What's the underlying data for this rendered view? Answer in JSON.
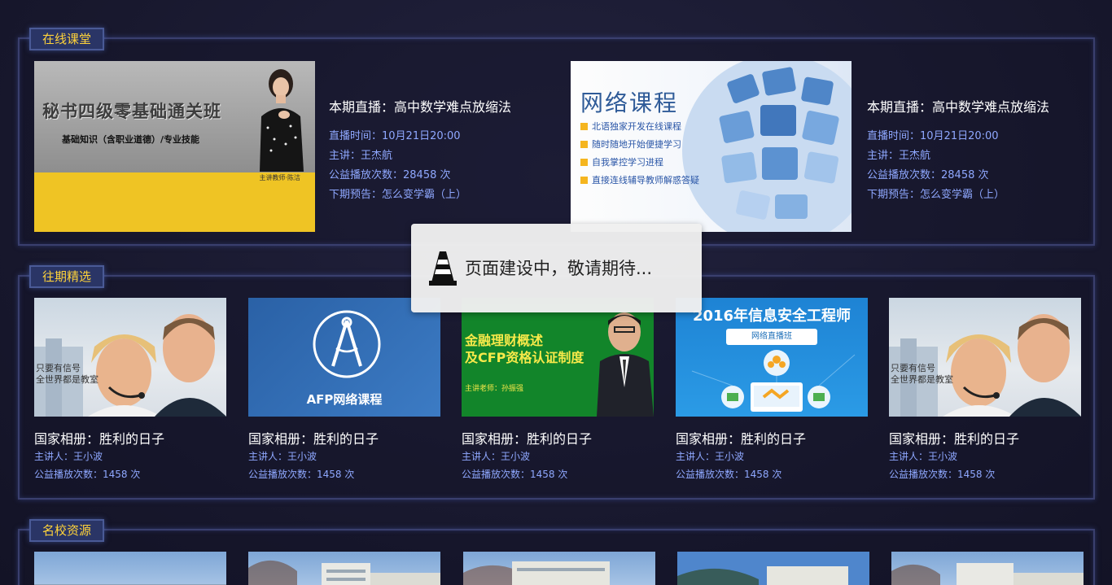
{
  "sections": {
    "live": {
      "tag": "在线课堂"
    },
    "history": {
      "tag": "往期精选"
    },
    "schools": {
      "tag": "名校资源"
    }
  },
  "live_items": [
    {
      "thumb_title": "秘书四级零基础通关班",
      "thumb_subtitle": "基础知识（含职业道德）/专业技能",
      "thumb_signature": "主讲教师·陈洁",
      "title": "本期直播：高中数学难点放缩法",
      "time": "直播时间：10月21日20:00",
      "speaker": "主讲：王杰航",
      "plays": "公益播放次数：28458 次",
      "next": "下期预告：怎么变学霸（上）"
    },
    {
      "thumb_title": "网络课程",
      "thumb_bullets": [
        "北语独家开发在线课程",
        "随时随地开始便捷学习",
        "自我掌控学习进程",
        "直接连线辅导教师解惑答疑"
      ],
      "title": "本期直播：高中数学难点放缩法",
      "time": "直播时间：10月21日20:00",
      "speaker": "主讲：王杰航",
      "plays": "公益播放次数：28458 次",
      "next": "下期预告：怎么变学霸（上）"
    }
  ],
  "history_items": [
    {
      "title": "国家相册：胜利的日子",
      "speaker": "主讲人：王小波",
      "plays": "公益播放次数：1458 次",
      "img_caption_1": "只要有信号",
      "img_caption_2": "全世界都是教室"
    },
    {
      "title": "国家相册：胜利的日子",
      "speaker": "主讲人：王小波",
      "plays": "公益播放次数：1458 次",
      "img_caption": "AFP网络课程"
    },
    {
      "title": "国家相册：胜利的日子",
      "speaker": "主讲人：王小波",
      "plays": "公益播放次数：1458 次",
      "img_caption_1": "金融理财概述",
      "img_caption_2": "及CFP资格认证制度",
      "img_caption_3": "主讲老师：孙振强"
    },
    {
      "title": "国家相册：胜利的日子",
      "speaker": "主讲人：王小波",
      "plays": "公益播放次数：1458 次",
      "img_caption": "2016年信息安全工程师",
      "img_badge": "网络直播班"
    },
    {
      "title": "国家相册：胜利的日子",
      "speaker": "主讲人：王小波",
      "plays": "公益播放次数：1458 次",
      "img_caption_1": "只要有信号",
      "img_caption_2": "全世界都是教室"
    }
  ],
  "popup": {
    "text": "页面建设中，敬请期待...",
    "icon": "traffic-cone-icon"
  },
  "colors": {
    "accent_yellow": "#ffd33a",
    "meta_blue": "#8fa8ff",
    "border": "#3a3f6e"
  }
}
